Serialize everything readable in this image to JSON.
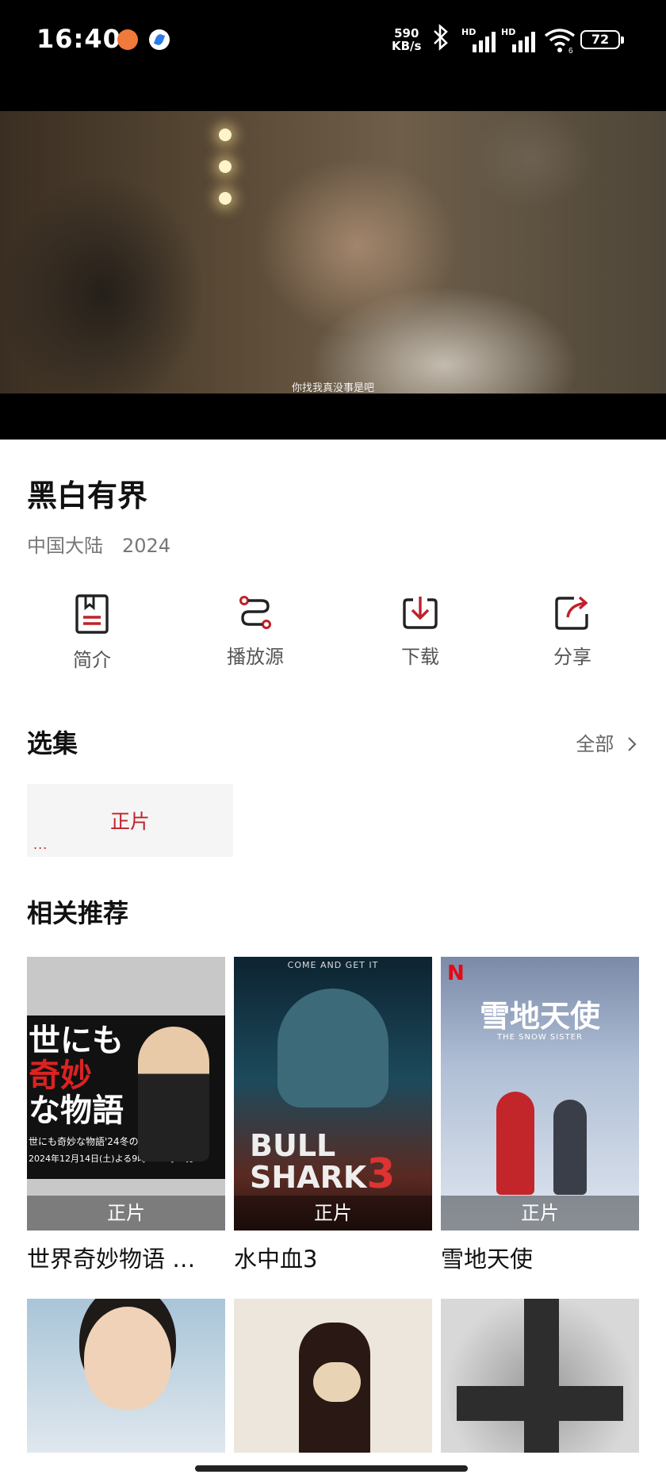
{
  "status_bar": {
    "time": "16:40",
    "net_speed_value": "590",
    "net_speed_unit": "KB/s",
    "sim1_label": "HD",
    "sim2_label": "HD",
    "wifi_label": "6",
    "battery": "72",
    "icons": [
      "notification-orange-icon",
      "notification-blue-icon",
      "bluetooth-icon",
      "signal-icon",
      "signal-icon",
      "wifi-icon",
      "battery-icon"
    ]
  },
  "player": {
    "subtitle": "你找我真没事是吧"
  },
  "movie": {
    "title": "黑白有界",
    "region": "中国大陆",
    "year": "2024"
  },
  "actions": [
    {
      "label": "简介",
      "icon": "intro-book-icon"
    },
    {
      "label": "播放源",
      "icon": "source-route-icon"
    },
    {
      "label": "下载",
      "icon": "download-icon"
    },
    {
      "label": "分享",
      "icon": "share-icon"
    }
  ],
  "episodes": {
    "title": "选集",
    "all_label": "全部",
    "items": [
      {
        "label": "正片",
        "extra": "..."
      }
    ]
  },
  "recommend": {
    "title": "相关推荐",
    "items": [
      {
        "name": "世界奇妙物语 …",
        "badge": "正片",
        "poster_text": [
          "世にも",
          "奇妙",
          "な物語"
        ],
        "poster_sub": "世にも奇妙な物語'24冬の特別編",
        "poster_date": "2024年12月14日(土)よる9時〜11時10分"
      },
      {
        "name": "水中血3",
        "badge": "正片",
        "poster_top": "COME AND GET IT",
        "poster_title": "BULL SHARK",
        "poster_num": "3"
      },
      {
        "name": "雪地天使",
        "badge": "正片",
        "poster_logo": "N",
        "poster_cn": "雪地天使",
        "poster_en": "THE SNOW SISTER"
      },
      {
        "name": "",
        "badge": ""
      },
      {
        "name": "",
        "badge": ""
      },
      {
        "name": "",
        "badge": ""
      }
    ]
  },
  "colors": {
    "accent": "#c0202a",
    "icon_dark": "#222222",
    "muted_text": "#777777"
  }
}
